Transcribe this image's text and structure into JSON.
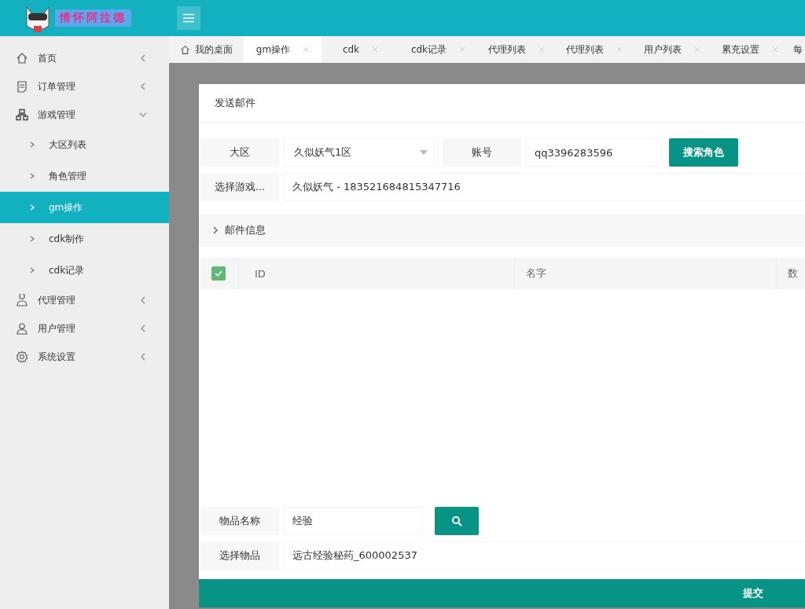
{
  "logo": {
    "text": "情怀阿拉德"
  },
  "tabs": [
    {
      "label": "我的桌面",
      "kind": "home",
      "selected": false
    },
    {
      "label": "gm操作",
      "kind": "closable",
      "selected": true
    },
    {
      "label": "cdk",
      "kind": "closable",
      "selected": false
    },
    {
      "label": "cdk记录",
      "kind": "closable",
      "selected": false
    },
    {
      "label": "代理列表",
      "kind": "closable",
      "selected": false
    },
    {
      "label": "代理列表",
      "kind": "closable",
      "selected": false
    },
    {
      "label": "用户列表",
      "kind": "closable",
      "selected": false
    },
    {
      "label": "累充设置",
      "kind": "closable",
      "selected": false
    },
    {
      "label": "每",
      "kind": "cut",
      "selected": false
    }
  ],
  "sidebar": {
    "items": [
      {
        "label": "首页",
        "expanded": false,
        "selected": false
      },
      {
        "label": "订单管理",
        "expanded": false,
        "selected": false
      },
      {
        "label": "游戏管理",
        "expanded": true,
        "selected": false,
        "children": [
          {
            "label": "大区列表",
            "selected": false
          },
          {
            "label": "角色管理",
            "selected": false
          },
          {
            "label": "gm操作",
            "selected": true
          },
          {
            "label": "cdk制作",
            "selected": false
          },
          {
            "label": "cdk记录",
            "selected": false
          }
        ]
      },
      {
        "label": "代理管理",
        "expanded": false,
        "selected": false
      },
      {
        "label": "用户管理",
        "expanded": false,
        "selected": false
      },
      {
        "label": "系统设置",
        "expanded": false,
        "selected": false
      }
    ]
  },
  "dialog": {
    "title": "发送邮件",
    "region": {
      "label": "大区",
      "value": "久似妖气1区"
    },
    "account": {
      "label": "账号",
      "value": "qq3396283596"
    },
    "search_role_button": "搜索角色",
    "role": {
      "label": "选择游戏...",
      "value": "久似妖气 - 183521684815347716"
    },
    "mail_section": {
      "label": "邮件信息",
      "expanded": false
    },
    "table": {
      "select_all": {
        "checked": true
      },
      "columns": [
        "ID",
        "名字",
        "数"
      ]
    },
    "item_name": {
      "label": "物品名称",
      "value": "经验"
    },
    "item_select": {
      "label": "选择物品",
      "value": "远古经验秘药_600002537"
    },
    "submit_button": "提交"
  }
}
